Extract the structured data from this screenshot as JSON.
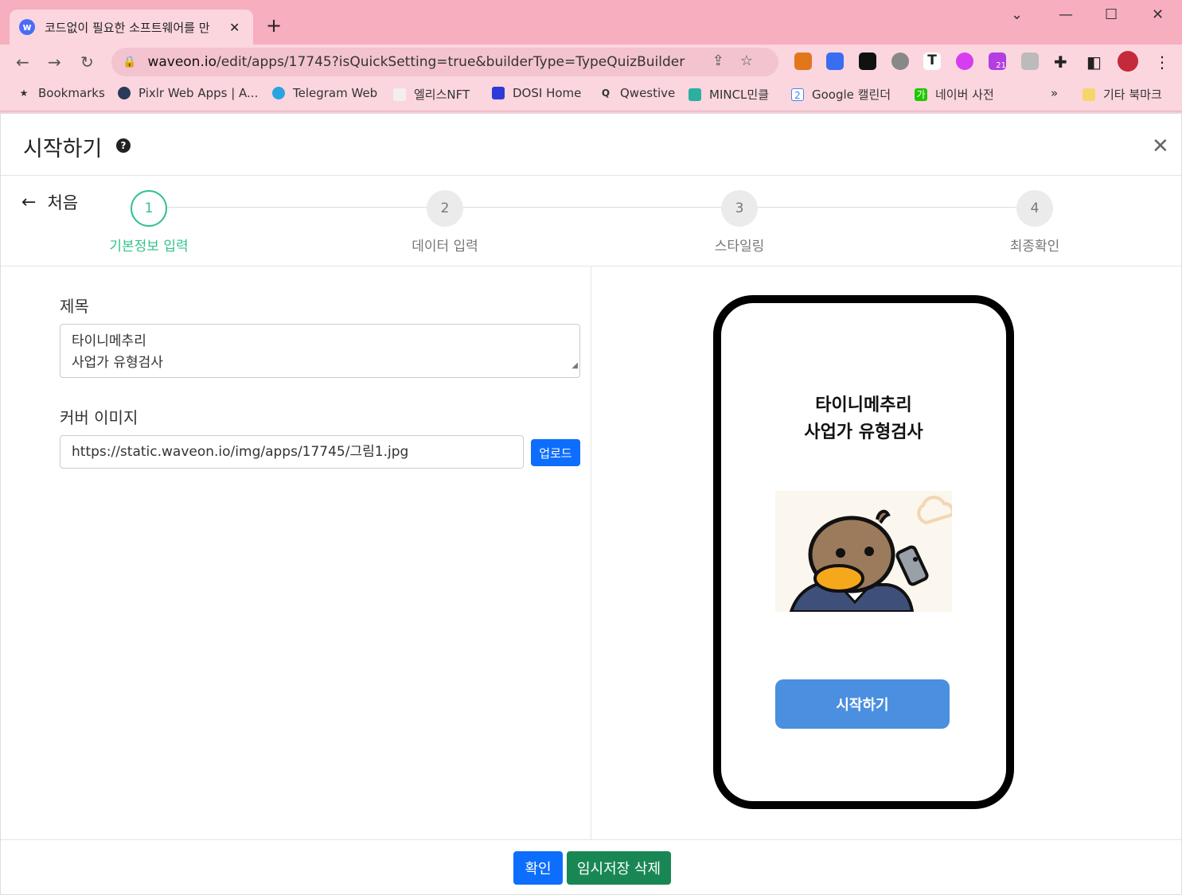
{
  "browser": {
    "tab_title": "코드없이 필요한 소프트웨어를 만",
    "favicon_letter": "w",
    "url_host": "waveon.io",
    "url_path": "/edit/apps/17745?isQuickSetting=true&builderType=TypeQuizBuilder",
    "extension_badge": "21"
  },
  "bookmarks": [
    {
      "label": "Bookmarks",
      "icon": "star-icon"
    },
    {
      "label": "Pixlr Web Apps | A...",
      "icon": "pixlr-icon"
    },
    {
      "label": "Telegram Web",
      "icon": "telegram-icon"
    },
    {
      "label": "엘리스NFT",
      "icon": "rabbit-icon"
    },
    {
      "label": "DOSI Home",
      "icon": "dosi-icon"
    },
    {
      "label": "Qwestive",
      "icon": "qwestive-icon"
    },
    {
      "label": "MINCL민클",
      "icon": "mincl-icon"
    },
    {
      "label": "Google 캘린더",
      "icon": "calendar-icon"
    },
    {
      "label": "네이버 사전",
      "icon": "naver-dict-icon"
    }
  ],
  "bookmarks_more": "»",
  "bookmarks_other": "기타 북마크",
  "modal": {
    "title": "시작하기",
    "help": "?",
    "back_label": "처음",
    "steps": [
      {
        "num": "1",
        "label": "기본정보 입력"
      },
      {
        "num": "2",
        "label": "데이터 입력"
      },
      {
        "num": "3",
        "label": "스타일링"
      },
      {
        "num": "4",
        "label": "최종확인"
      }
    ],
    "active_step": 1,
    "form": {
      "title_label": "제목",
      "title_line1": "타이니메추리",
      "title_line2": "사업가 유형검사",
      "cover_label": "커버 이미지",
      "cover_url": "https://static.waveon.io/img/apps/17745/그림1.jpg",
      "upload_label": "업로드"
    },
    "preview": {
      "title_line1": "타이니메추리",
      "title_line2": "사업가 유형검사",
      "start_button": "시작하기"
    },
    "footer": {
      "confirm_label": "확인",
      "delete_draft_label": "임시저장 삭제"
    }
  },
  "colors": {
    "active_step": "#33c28b",
    "primary": "#0d6efd",
    "success": "#198754",
    "preview_button": "#4a8fe0",
    "tab_strip": "#f7aebf"
  }
}
